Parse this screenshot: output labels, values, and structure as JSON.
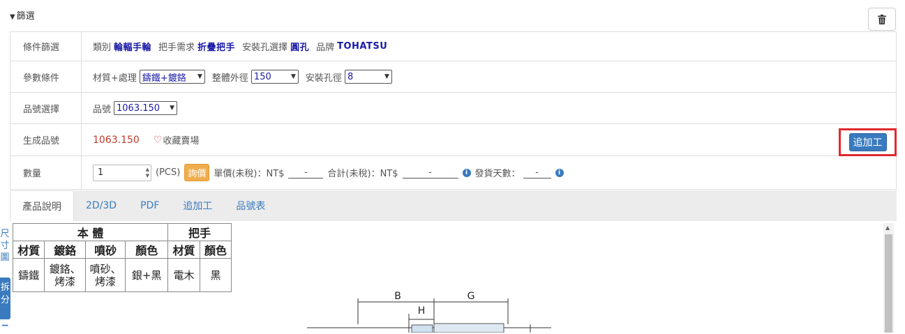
{
  "filter": {
    "title": "篩選"
  },
  "rows": {
    "conditions": {
      "label": "條件篩選",
      "tags": [
        {
          "label": "類別",
          "value": "輪輻手輪"
        },
        {
          "label": "把手需求",
          "value": "折疊把手"
        },
        {
          "label": "安裝孔選擇",
          "value": "圓孔"
        },
        {
          "label": "品牌",
          "value": "TOHATSU"
        }
      ]
    },
    "params": {
      "label": "參數條件",
      "material_label": "材質+處理",
      "material_value": "鑄鐵+鍍鉻",
      "diameter_label": "整體外徑",
      "diameter_value": "150",
      "hole_label": "安裝孔徑",
      "hole_value": "8"
    },
    "part_select": {
      "label": "品號選擇",
      "part_label": "品號",
      "part_value": "1063.150"
    },
    "generated": {
      "label": "生成品號",
      "part_no": "1063.150",
      "favorite": "收藏賣場",
      "add_process": "追加工"
    },
    "quantity": {
      "label": "數量",
      "value": "1",
      "unit": "(PCS)",
      "inquiry": "詢價",
      "unit_price_label": "單價(未稅)：NT$",
      "unit_price": "-",
      "total_label": "合計(未稅)：NT$",
      "total": "-",
      "delivery_label": "發貨天數：",
      "delivery": "-"
    }
  },
  "tabs": [
    "產品說明",
    "2D/3D",
    "PDF",
    "追加工",
    "品號表"
  ],
  "side": {
    "link": "尺寸圖",
    "split": "拆分"
  },
  "spec_table": {
    "group_body": "本 體",
    "group_handle": "把手",
    "headers": [
      "材質",
      "鍍鉻",
      "噴砂",
      "顏色",
      "材質",
      "顏色"
    ],
    "cells": [
      "鑄鐵",
      "鍍鉻、烤漆",
      "噴砂、烤漆",
      "銀+黑",
      "電木",
      "黑"
    ]
  },
  "drawing": {
    "labels": [
      "B",
      "H",
      "G"
    ]
  }
}
